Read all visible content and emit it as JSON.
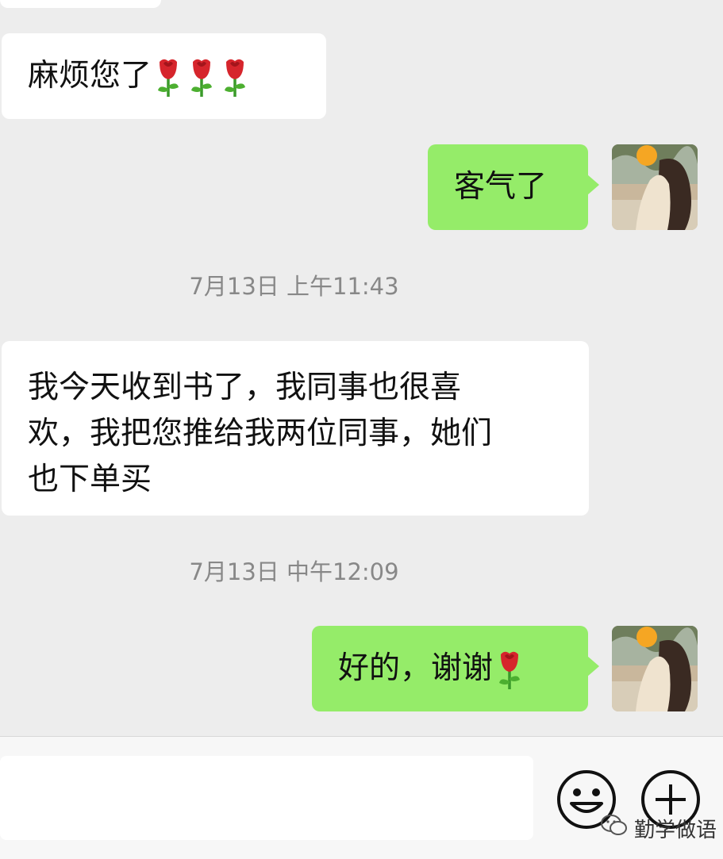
{
  "messages": [
    {
      "side": "in",
      "text": "麻烦您了",
      "roses": 3
    },
    {
      "side": "out",
      "text": "客气了"
    },
    {
      "timestamp": "7月13日 上午11:43"
    },
    {
      "side": "in",
      "lines": [
        "我今天收到书了，我同事也很喜",
        "欢，我把您推给我两位同事，她们",
        "也下单买"
      ]
    },
    {
      "timestamp": "7月13日 中午12:09"
    },
    {
      "side": "out",
      "text": "好的，谢谢",
      "roses": 1
    }
  ],
  "input": {
    "value": "",
    "placeholder": ""
  },
  "icons": {
    "emoji": "smiley-face-icon",
    "more": "plus-circle-icon",
    "rose": "rose-emoji-icon",
    "watermark": "wechat-logo-icon"
  },
  "watermark": {
    "text": "勤学做语"
  },
  "colors": {
    "background": "#ededed",
    "incoming": "#ffffff",
    "outgoing": "#95ec69",
    "timestamp": "#888888"
  }
}
